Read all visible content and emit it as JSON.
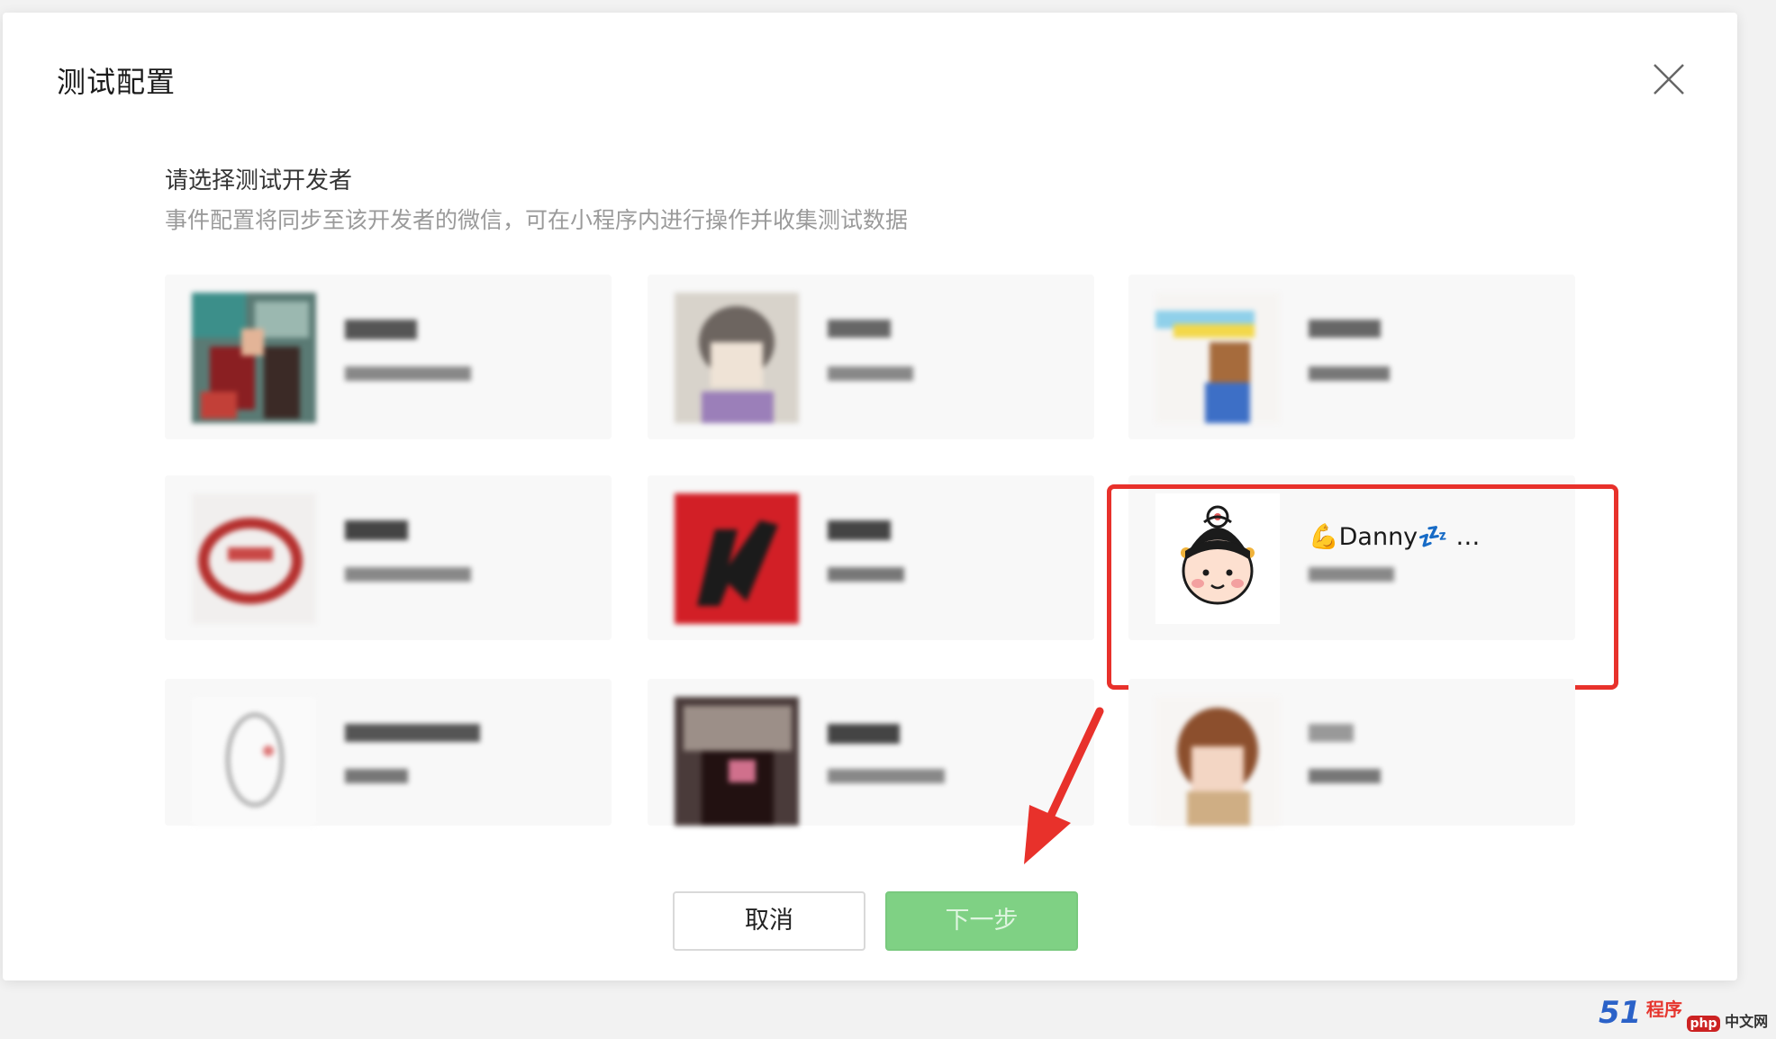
{
  "dialog": {
    "title": "测试配置"
  },
  "section": {
    "title": "请选择测试开发者",
    "description": "事件配置将同步至该开发者的微信，可在小程序内进行操作并收集测试数据"
  },
  "developers": [
    {
      "name": "",
      "sub": ""
    },
    {
      "name": "",
      "sub": ""
    },
    {
      "name": "",
      "sub": ""
    },
    {
      "name": "",
      "sub": ""
    },
    {
      "name": "",
      "sub": ""
    },
    {
      "name": "💪Danny💤 …",
      "sub": "",
      "selected": true
    },
    {
      "name": "",
      "sub": ""
    },
    {
      "name": "",
      "sub": ""
    },
    {
      "name": "",
      "sub": ""
    }
  ],
  "buttons": {
    "cancel": "取消",
    "next": "下一步"
  },
  "watermark": {
    "brand": "51",
    "text": "程序",
    "badge": "php",
    "site": "中文网"
  },
  "colors": {
    "accent_green": "#7fd184",
    "selection_red": "#e8312b"
  }
}
